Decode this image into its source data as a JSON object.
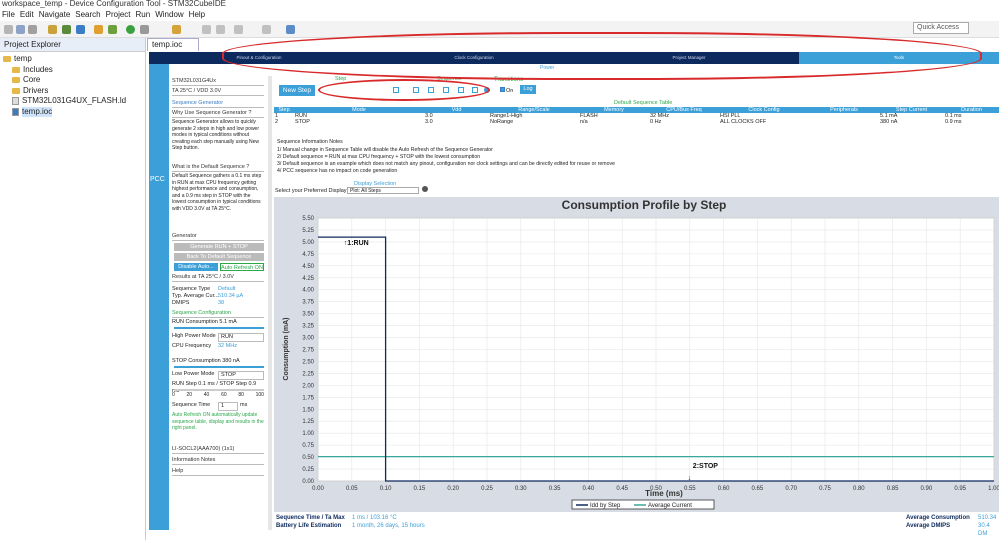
{
  "window": {
    "title": "workspace_temp - Device Configuration Tool - STM32CubeIDE"
  },
  "menu": [
    "File",
    "Edit",
    "Navigate",
    "Search",
    "Project",
    "Run",
    "Window",
    "Help"
  ],
  "quick_access": "Quick Access",
  "explorer": {
    "title": "Project Explorer",
    "items": [
      {
        "label": "temp",
        "level": 0
      },
      {
        "label": "Includes",
        "level": 1
      },
      {
        "label": "Core",
        "level": 1
      },
      {
        "label": "Drivers",
        "level": 1
      },
      {
        "label": "STM32L031G4UX_FLASH.ld",
        "level": 1
      },
      {
        "label": "temp.ioc",
        "level": 1
      }
    ]
  },
  "editor": {
    "tab": "temp.ioc"
  },
  "topnav": {
    "tabs": [
      "Pinout & Configuration",
      "Clock Configuration",
      "Project Manager",
      "Tools"
    ],
    "active": "Tools",
    "sub": "Power"
  },
  "side_label": "PCC",
  "panel": {
    "device": "STM32L031G4Ux",
    "conditions": "TA 25°C / VDD 3.0V",
    "seq_gen": "Sequence Generator",
    "why": "Why Use Sequence Generator ?",
    "why_text": "Sequence Generator allows to quickly generate 2 steps in high and low power modes in typical conditions without creating each step manually using New Step button.",
    "what": "What is the Default Sequence ?",
    "what_text": "Default Sequence gathers a 0.1 ms step in RUN at max CPU frequency getting highest performance and consumption, and a 0.9 ms step in STOP with the lowest consumption in typical conditions with VDD 3.0V at TA 25°C.",
    "generator": "Generator",
    "gen_btn": "Generate RUN + STOP",
    "back_btn": "Back To Default Sequence",
    "disable_btn": "Disable Auto...",
    "auto_refresh": "Auto Refresh ON",
    "results": "Results at TA 25°C / 3.0V",
    "seq_type_k": "Sequence Type",
    "seq_type_v": "Default",
    "avg_k": "Typ. Average Cur...",
    "avg_v": "510.34 µA",
    "dmips_k": "DMIPS",
    "dmips_v": "38",
    "seq_conf": "Sequence Configuration",
    "run_cons": "RUN Consumption 5.1 mA",
    "hp_k": "High Power Mode",
    "hp_v": "RUN",
    "cpu_k": "CPU Frequency",
    "cpu_v": "32 MHz",
    "stop_cons": "STOP Consumption 380 nA",
    "lp_k": "Low Power Mode",
    "lp_v": "STOP",
    "runstep": "RUN Step 0.1 ms / STOP Step 0.9 ms",
    "scale": [
      "0",
      "20",
      "40",
      "60",
      "80",
      "100"
    ],
    "seqtime_k": "Sequence Time",
    "seqtime_v": "1",
    "seqtime_u": "ms",
    "auto_text": "Auto Refresh ON automatically update sequence table, display and results in the right panel.",
    "battery": "LI-SOCL2(AAA700) (1x1)",
    "info": "Information Notes",
    "help": "Help"
  },
  "step_label": "Step",
  "sequence_label": "Sequence",
  "transitions_label": "Transitions",
  "new_step": "New Step",
  "on": "On",
  "log": "Log",
  "table": {
    "title": "Default Sequence Table",
    "headers": [
      "Step",
      "Mode",
      "Vdd",
      "Range/Scale",
      "Memory",
      "CPU/Bus Freq",
      "Clock Config",
      "Peripherals",
      "Step Current",
      "Duration"
    ],
    "rows": [
      [
        "1",
        "RUN",
        "3.0",
        "Range1-High",
        "FLASH",
        "32 MHz",
        "HSI PLL",
        "",
        "5.1 mA",
        "0.1 ms"
      ],
      [
        "2",
        "STOP",
        "3.0",
        "NoRange",
        "n/a",
        "0 Hz",
        "ALL CLOCKS OFF",
        "",
        "380 nA",
        "0.9 ms"
      ]
    ]
  },
  "notes": {
    "title": "Sequence Information Notes",
    "lines": [
      "1/ Manual change in Sequence Table will disable the Auto Refresh of the Sequence Generator",
      "2/ Default sequence = RUN at max CPU frequency + STOP with the lowest consumption",
      "3/ Default sequence is an example which does not match any pinout, configuration nor clock settings and can be directly edited for reuse or remove",
      "4/ PCC sequence has no impact on code generation"
    ]
  },
  "display": {
    "label": "Display Selection",
    "prompt": "Select your Preferred Display",
    "value": "Plot: All Steps"
  },
  "chart_data": {
    "type": "line",
    "title": "Consumption Profile by Step",
    "xlabel": "Time (ms)",
    "ylabel": "Consumption (mA)",
    "xlim": [
      0,
      1.0
    ],
    "ylim": [
      0,
      5.5
    ],
    "xticks": [
      "0.00",
      "0.05",
      "0.10",
      "0.15",
      "0.20",
      "0.25",
      "0.30",
      "0.35",
      "0.40",
      "0.45",
      "0.50",
      "0.55",
      "0.60",
      "0.65",
      "0.70",
      "0.75",
      "0.80",
      "0.85",
      "0.90",
      "0.95",
      "1.00"
    ],
    "yticks": [
      "0.00",
      "0.25",
      "0.50",
      "0.75",
      "1.00",
      "1.25",
      "1.50",
      "1.75",
      "2.00",
      "2.25",
      "2.50",
      "2.75",
      "3.00",
      "3.25",
      "3.50",
      "3.75",
      "4.00",
      "4.25",
      "4.50",
      "4.75",
      "5.00",
      "5.25",
      "5.50"
    ],
    "series": [
      {
        "name": "Idd by Step",
        "color": "#0d2a5e",
        "x": [
          0,
          0.1,
          0.1,
          1.0
        ],
        "y": [
          5.1,
          5.1,
          0.00038,
          0.00038
        ]
      },
      {
        "name": "Average Current",
        "color": "#3aa89a",
        "x": [
          0,
          1.0
        ],
        "y": [
          0.51,
          0.51
        ]
      }
    ],
    "annotations": [
      {
        "text": "1:RUN",
        "x": 0.05,
        "y": 5.0
      },
      {
        "text": "2:STOP",
        "x": 0.55,
        "y": 0.1
      }
    ],
    "legend": "bottom-center"
  },
  "footer": {
    "seqtime_k": "Sequence Time / Ta Max",
    "seqtime_v": "1 ms / 103.16 °C",
    "batt_k": "Battery Life Estimation",
    "batt_v": "1 month, 26 days, 15 hours",
    "avgcons_k": "Average Consumption",
    "avgcons_v": "510.34",
    "avgdmips_k": "Average DMIPS",
    "avgdmips_v": "30.4 DM"
  }
}
